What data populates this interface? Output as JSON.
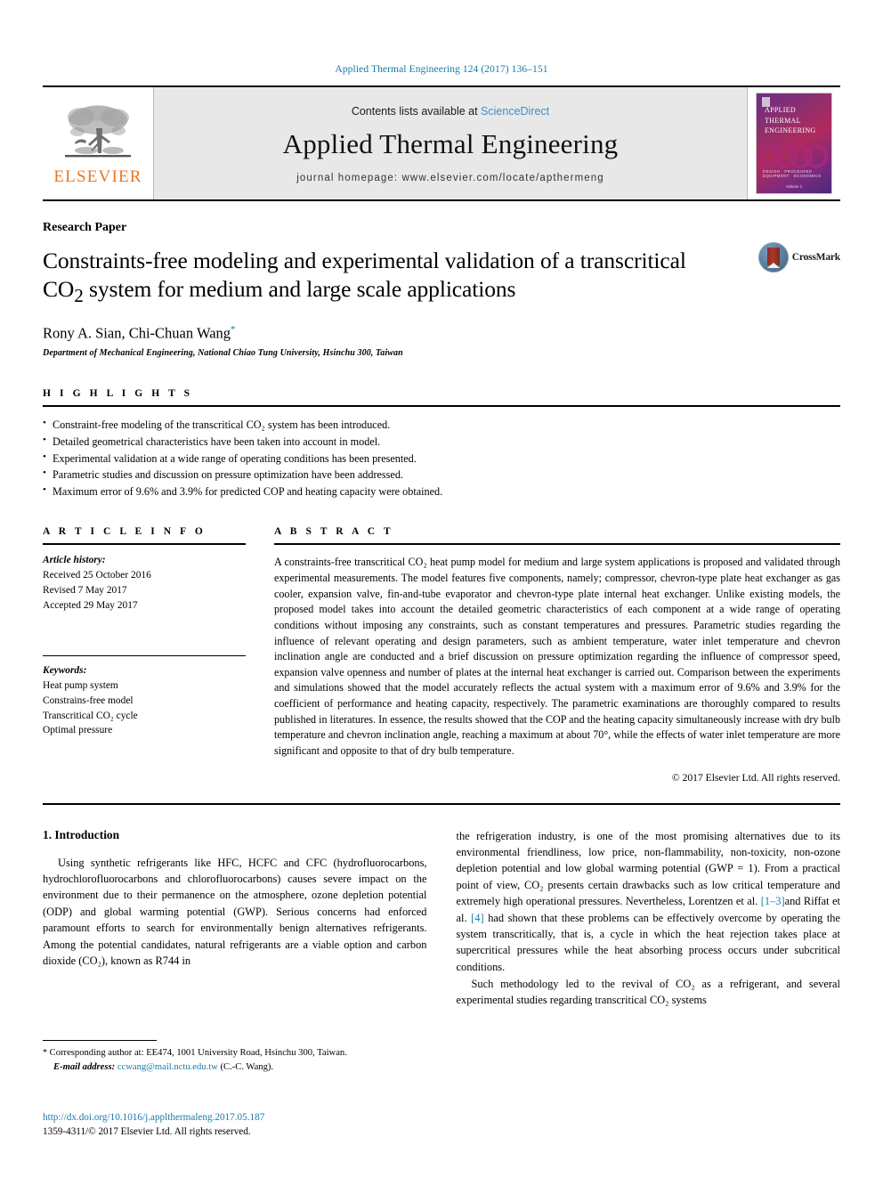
{
  "running_head": "Applied Thermal Engineering 124 (2017) 136–151",
  "masthead": {
    "publisher_name": "ELSEVIER",
    "contents_prefix": "Contents lists available at ",
    "contents_link": "ScienceDirect",
    "journal_title": "Applied Thermal Engineering",
    "homepage_label": "journal homepage: www.elsevier.com/locate/apthermeng",
    "cover": {
      "line1": "APPLIED",
      "line2": "THERMAL",
      "line3": "ENGINEERING",
      "footer_small": "DESIGN · PROCESSES · EQUIPMENT · ECONOMICS",
      "footer_vol": "Volume 1"
    }
  },
  "article": {
    "kicker": "Research Paper",
    "title_line1": "Constraints-free modeling and experimental validation of a transcritical",
    "title_line2_pre": "CO",
    "title_line2_sub": "2",
    "title_line2_post": " system for medium and large scale applications",
    "authors": "Rony A. Sian, Chi-Chuan Wang",
    "author_star": "*",
    "affiliation": "Department of Mechanical Engineering, National Chiao Tung University, Hsinchu 300, Taiwan",
    "crossmark_label": "CrossMark"
  },
  "highlights": {
    "label": "H I G H L I G H T S",
    "items": [
      "Constraint-free modeling of the transcritical CO₂ system has been introduced.",
      "Detailed geometrical characteristics have been taken into account in model.",
      "Experimental validation at a wide range of operating conditions has been presented.",
      "Parametric studies and discussion on pressure optimization have been addressed.",
      "Maximum error of 9.6% and 3.9% for predicted COP and heating capacity were obtained."
    ]
  },
  "article_info": {
    "label": "A R T I C L E   I N F O",
    "history_label": "Article history:",
    "history": [
      "Received 25 October 2016",
      "Revised 7 May 2017",
      "Accepted 29 May 2017"
    ],
    "keywords_label": "Keywords:",
    "keywords": [
      "Heat pump system",
      "Constrains-free model",
      "Transcritical CO₂ cycle",
      "Optimal pressure"
    ]
  },
  "abstract": {
    "label": "A B S T R A C T",
    "text": "A constraints-free transcritical CO₂ heat pump model for medium and large system applications is proposed and validated through experimental measurements. The model features five components, namely; compressor, chevron-type plate heat exchanger as gas cooler, expansion valve, fin-and-tube evaporator and chevron-type plate internal heat exchanger. Unlike existing models, the proposed model takes into account the detailed geometric characteristics of each component at a wide range of operating conditions without imposing any constraints, such as constant temperatures and pressures. Parametric studies regarding the influence of relevant operating and design parameters, such as ambient temperature, water inlet temperature and chevron inclination angle are conducted and a brief discussion on pressure optimization regarding the influence of compressor speed, expansion valve openness and number of plates at the internal heat exchanger is carried out. Comparison between the experiments and simulations showed that the model accurately reflects the actual system with a maximum error of 9.6% and 3.9% for the coefficient of performance and heating capacity, respectively. The parametric examinations are thoroughly compared to results published in literatures. In essence, the results showed that the COP and the heating capacity simultaneously increase with dry bulb temperature and chevron inclination angle, reaching a maximum at about 70°, while the effects of water inlet temperature are more significant and opposite to that of dry bulb temperature.",
    "copyright": "© 2017 Elsevier Ltd. All rights reserved."
  },
  "introduction": {
    "heading": "1. Introduction",
    "left_para1": "Using synthetic refrigerants like HFC, HCFC and CFC (hydrofluorocarbons, hydrochlorofluorocarbons and chlorofluorocarbons) causes severe impact on the environment due to their permanence on the atmosphere, ozone depletion potential (ODP) and global warming potential (GWP). Serious concerns had enforced paramount efforts to search for environmentally benign alternatives refrigerants. Among the potential candidates, natural refrigerants are a viable option and carbon dioxide (CO₂), known as R744 in",
    "right_para1_a": "the refrigeration industry, is one of the most promising alternatives due to its environmental friendliness, low price, non-flammability, non-toxicity, non-ozone depletion potential and low global warming potential (GWP = 1). From a practical point of view, CO₂ presents certain drawbacks such as low critical temperature and extremely high operational pressures. Nevertheless, Lorentzen et al. ",
    "ref1": "[1–3]",
    "right_para1_b": "and Riffat et al. ",
    "ref2": "[4]",
    "right_para1_c": " had shown that these problems can be effectively overcome by operating the system transcritically, that is, a cycle in which the heat rejection takes place at supercritical pressures while the heat absorbing process occurs under subcritical conditions.",
    "right_para2": "Such methodology led to the revival of CO₂ as a refrigerant, and several experimental studies regarding transcritical CO₂ systems"
  },
  "footnote": {
    "marker": "*",
    "line1": " Corresponding author at: EE474, 1001 University Road, Hsinchu 300, Taiwan.",
    "email_label": "E-mail address:",
    "email": "ccwang@mail.nctu.edu.tw",
    "email_suffix": " (C.-C. Wang)."
  },
  "footer": {
    "doi": "http://dx.doi.org/10.1016/j.applthermaleng.2017.05.187",
    "issn_line": "1359-4311/© 2017 Elsevier Ltd. All rights reserved."
  },
  "colors": {
    "link": "#1a7aab",
    "sciencedirect": "#3f8fc4",
    "elsevier_orange": "#e87722"
  }
}
